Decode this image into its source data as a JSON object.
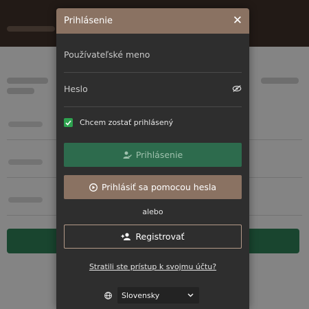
{
  "modal": {
    "title": "Prihlásenie",
    "username_placeholder": "Používateľské meno",
    "password_placeholder": "Heslo",
    "remember_label": "Chcem zostať prihlásený",
    "remember_checked": true,
    "login_button": "Prihlásenie",
    "password_login_button": "Prihlásiť sa pomocou hesla",
    "or_text": "alebo",
    "register_button": "Registrovať",
    "lost_access_link": "Stratili ste prístup k svojmu účtu?",
    "language": "Slovensky"
  },
  "colors": {
    "header": "#8a7262",
    "login_button": "#2d6b4d",
    "checkbox": "#2ea24f",
    "modal_bg": "#2e2e2e"
  }
}
